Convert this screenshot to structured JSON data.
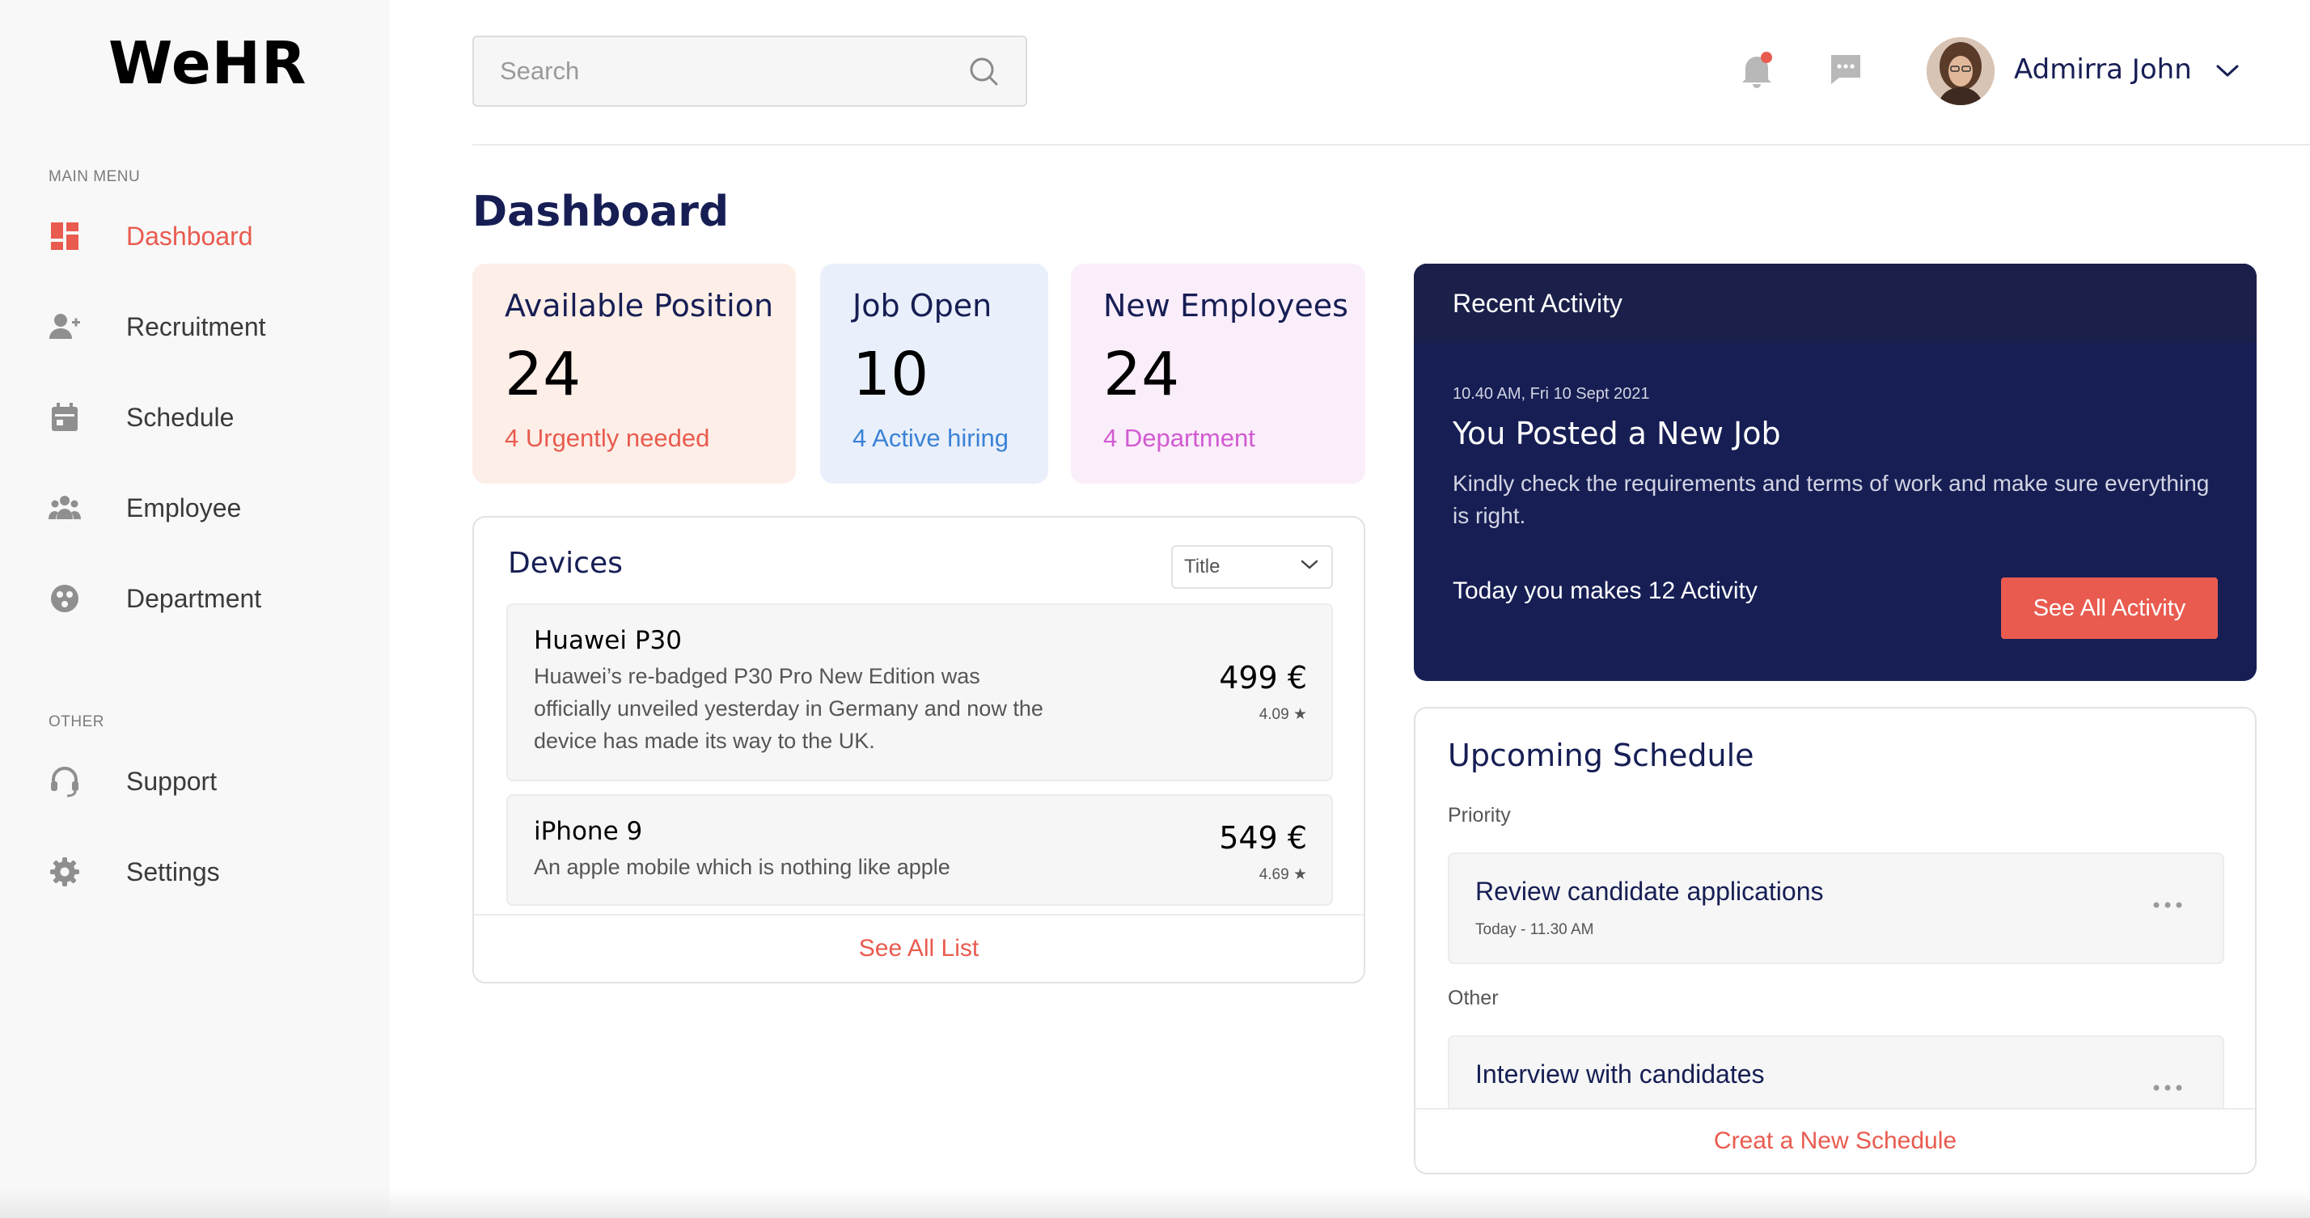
{
  "app": {
    "logo": "WeHR"
  },
  "sidebar": {
    "main_label": "MAIN MENU",
    "other_label": "OTHER",
    "items": [
      {
        "label": "Dashboard",
        "icon": "dashboard-icon"
      },
      {
        "label": "Recruitment",
        "icon": "add-user-icon"
      },
      {
        "label": "Schedule",
        "icon": "calendar-icon"
      },
      {
        "label": "Employee",
        "icon": "people-icon"
      },
      {
        "label": "Department",
        "icon": "department-icon"
      }
    ],
    "other_items": [
      {
        "label": "Support",
        "icon": "headset-icon"
      },
      {
        "label": "Settings",
        "icon": "gear-icon"
      }
    ]
  },
  "header": {
    "search_placeholder": "Search",
    "user_name": "Admirra John"
  },
  "page": {
    "title": "Dashboard"
  },
  "stats": [
    {
      "title": "Available Position",
      "value": "24",
      "sub": "4 Urgently needed",
      "bg": "#fdefe8",
      "accent": "#e95b4f"
    },
    {
      "title": "Job Open",
      "value": "10",
      "sub": "4 Active hiring",
      "bg": "#e9f0fb",
      "accent": "#3b82d6"
    },
    {
      "title": "New Employees",
      "value": "24",
      "sub": "4 Department",
      "bg": "#fbeefb",
      "accent": "#d25ad1"
    }
  ],
  "devices": {
    "title": "Devices",
    "filter": "Title",
    "items": [
      {
        "name": "Huawei P30",
        "desc": "Huawei’s re-badged P30 Pro New Edition was officially unveiled yesterday in Germany and now the device has made its way to the UK.",
        "price": "499 €",
        "rating": "4.09 ★"
      },
      {
        "name": "iPhone 9",
        "desc": "An apple mobile which is nothing like apple",
        "price": "549 €",
        "rating": "4.69 ★"
      }
    ],
    "see_all": "See All List"
  },
  "activity": {
    "title": "Recent Activity",
    "time": "10.40 AM, Fri 10 Sept 2021",
    "headline": "You Posted a New Job",
    "body": "Kindly check the requirements and terms of work and make sure everything is right.",
    "count_text": "Today you makes 12 Activity",
    "button": "See All Activity"
  },
  "schedule": {
    "title": "Upcoming Schedule",
    "priority_label": "Priority",
    "other_label": "Other",
    "priority_item": {
      "title": "Review candidate applications",
      "when": "Today - 11.30 AM"
    },
    "other_item": {
      "title": "Interview with candidates"
    },
    "create": "Creat a New Schedule"
  },
  "colors": {
    "accent": "#e95b4f",
    "navy": "#161e54"
  }
}
